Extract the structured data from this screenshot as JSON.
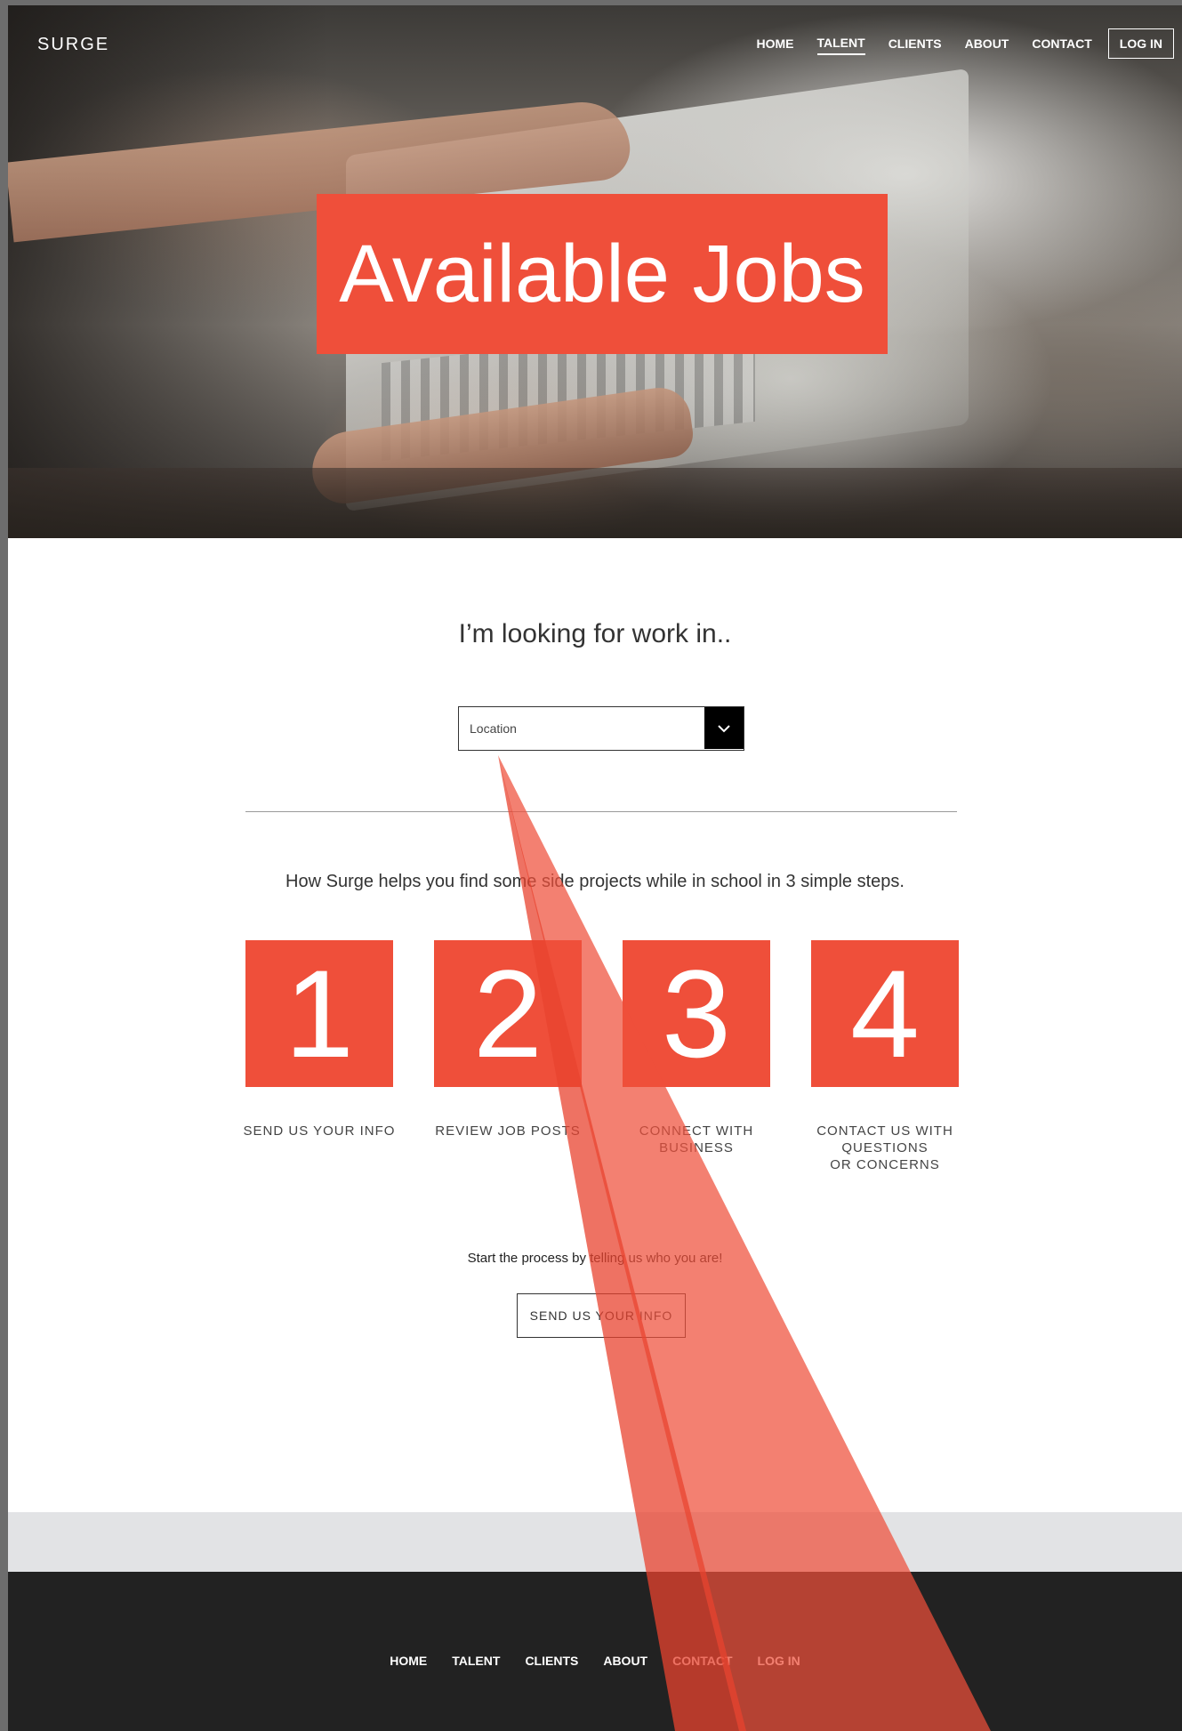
{
  "brand": "SURGE",
  "nav": {
    "home": "HOME",
    "talent": "TALENT",
    "clients": "CLIENTS",
    "about": "ABOUT",
    "contact": "CONTACT",
    "login": "LOG IN"
  },
  "hero": {
    "title": "Available Jobs"
  },
  "search": {
    "heading": "I’m looking for work in..",
    "location_value": "Location"
  },
  "steps": {
    "intro": "How Surge helps you find some side projects while in school in 3 simple steps.",
    "items": [
      {
        "number": "1",
        "label": "SEND US YOUR INFO"
      },
      {
        "number": "2",
        "label": "REVIEW JOB POSTS"
      },
      {
        "number": "3",
        "label": "CONNECT WITH\nBUSINESS"
      },
      {
        "number": "4",
        "label": "CONTACT US WITH\nQUESTIONS\nOR CONCERNS"
      }
    ]
  },
  "cta": {
    "text": "Start the process by telling us who you are!",
    "button": "SEND US YOUR INFO"
  },
  "footer": {
    "home": "HOME",
    "talent": "TALENT",
    "clients": "CLIENTS",
    "about": "ABOUT",
    "contact": "CONTACT",
    "login": "LOG IN"
  },
  "colors": {
    "accent": "#ef4f3a",
    "footer_bg": "#222222",
    "footer_band": "#e2e3e5"
  }
}
